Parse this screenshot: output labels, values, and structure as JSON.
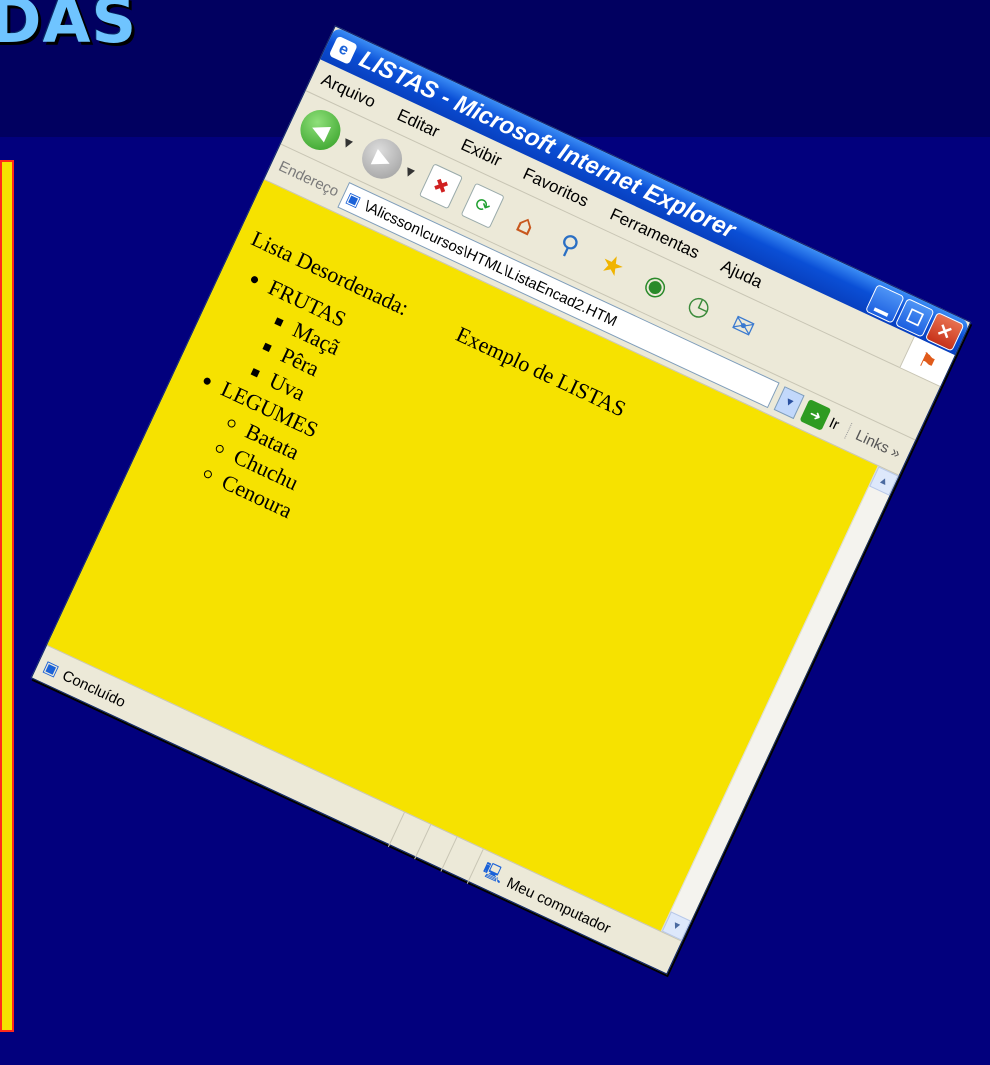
{
  "slide": {
    "title": "DAS"
  },
  "window": {
    "title": "LISTAS - Microsoft Internet Explorer",
    "controls": [
      "minimize",
      "maximize",
      "close"
    ]
  },
  "menu": {
    "items": [
      "Arquivo",
      "Editar",
      "Exibir",
      "Favoritos",
      "Ferramentas",
      "Ajuda"
    ]
  },
  "toolbar": {
    "buttons": [
      "back",
      "forward",
      "stop",
      "refresh",
      "home",
      "search",
      "favorites",
      "media",
      "history",
      "mail"
    ]
  },
  "address": {
    "label": "Endereço",
    "value": "\\Alicsson\\cursos\\HTML\\ListaEncad2.HTM",
    "go_label": "Ir",
    "links_label": "Links"
  },
  "page": {
    "heading": "Exemplo de LISTAS",
    "lead": "Lista Desordenada:",
    "list": [
      {
        "label": "FRUTAS",
        "children": [
          "Maçã",
          "Pêra",
          "Uva"
        ]
      },
      {
        "label": "LEGUMES",
        "children": [
          "Batata",
          "Chuchu",
          "Cenoura"
        ]
      }
    ]
  },
  "status": {
    "left": "Concluído",
    "zone": "Meu computador"
  },
  "colors": {
    "slide_bg": "#02007d",
    "title_band": "#010060",
    "title_text": "#6fc4ff",
    "page_bg": "#f6e200",
    "left_box_border": "#ff2a1a"
  }
}
